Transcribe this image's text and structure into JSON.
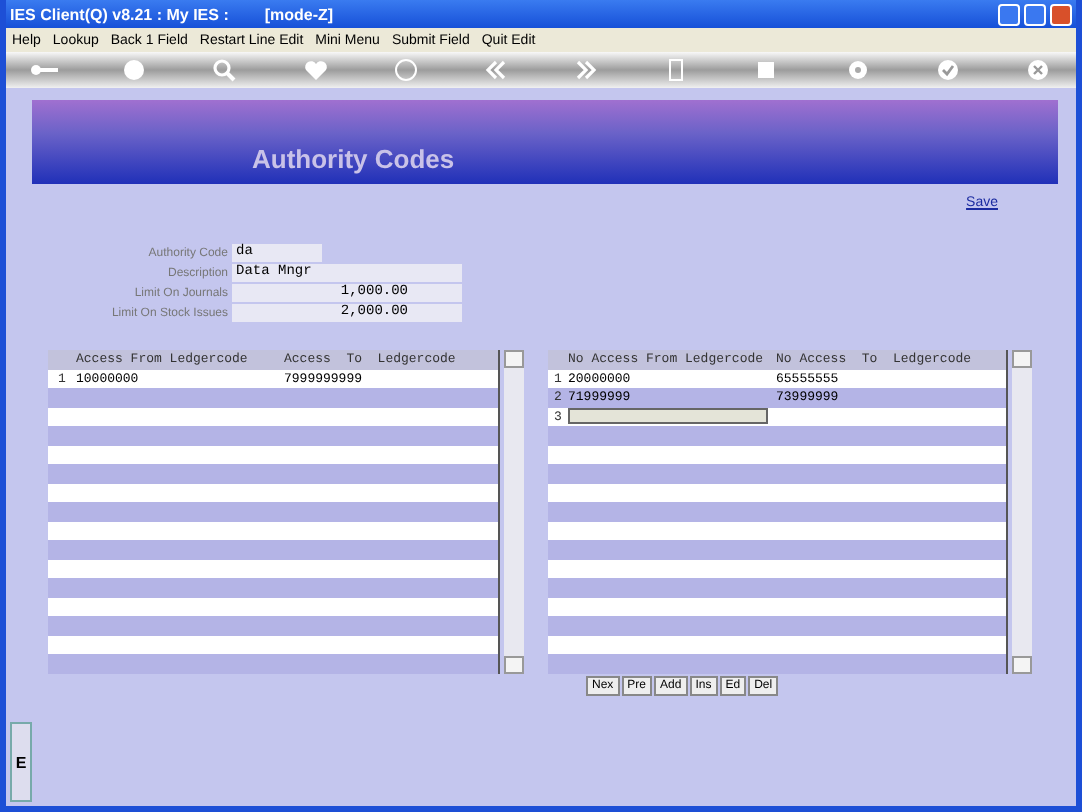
{
  "window": {
    "title": "IES Client(Q) v8.21 : My IES :",
    "mode": "[mode-Z]"
  },
  "menu": [
    "Help",
    "Lookup",
    "Back 1 Field",
    "Restart Line Edit",
    "Mini Menu",
    "Submit Field",
    "Quit Edit"
  ],
  "banner": {
    "title": "Authority Codes"
  },
  "save_link": "Save",
  "form": [
    {
      "label": "Authority Code",
      "value": "da",
      "kind": "code"
    },
    {
      "label": "Description",
      "value": "Data Mngr",
      "kind": "text"
    },
    {
      "label": "Limit On Journals",
      "value": "1,000.00",
      "kind": "amount"
    },
    {
      "label": "Limit On Stock Issues",
      "value": "2,000.00",
      "kind": "amount"
    }
  ],
  "access_table": {
    "columns": [
      "Access From Ledgercode",
      "Access  To  Ledgercode"
    ],
    "rows": [
      {
        "number": "1",
        "cells": [
          "10000000",
          "7999999999"
        ]
      }
    ]
  },
  "no_access_table": {
    "columns": [
      "No Access From Ledgercode",
      "No Access  To  Ledgercode"
    ],
    "rows": [
      {
        "number": "1",
        "cells": [
          "20000000",
          "65555555"
        ]
      },
      {
        "number": "2",
        "cells": [
          "71999999",
          "73999999"
        ]
      },
      {
        "number": "3"
      }
    ]
  },
  "row_buttons": [
    "Nex",
    "Pre",
    "Add",
    "Ins",
    "Ed",
    "Del"
  ],
  "side_tab": {
    "label": "E"
  }
}
